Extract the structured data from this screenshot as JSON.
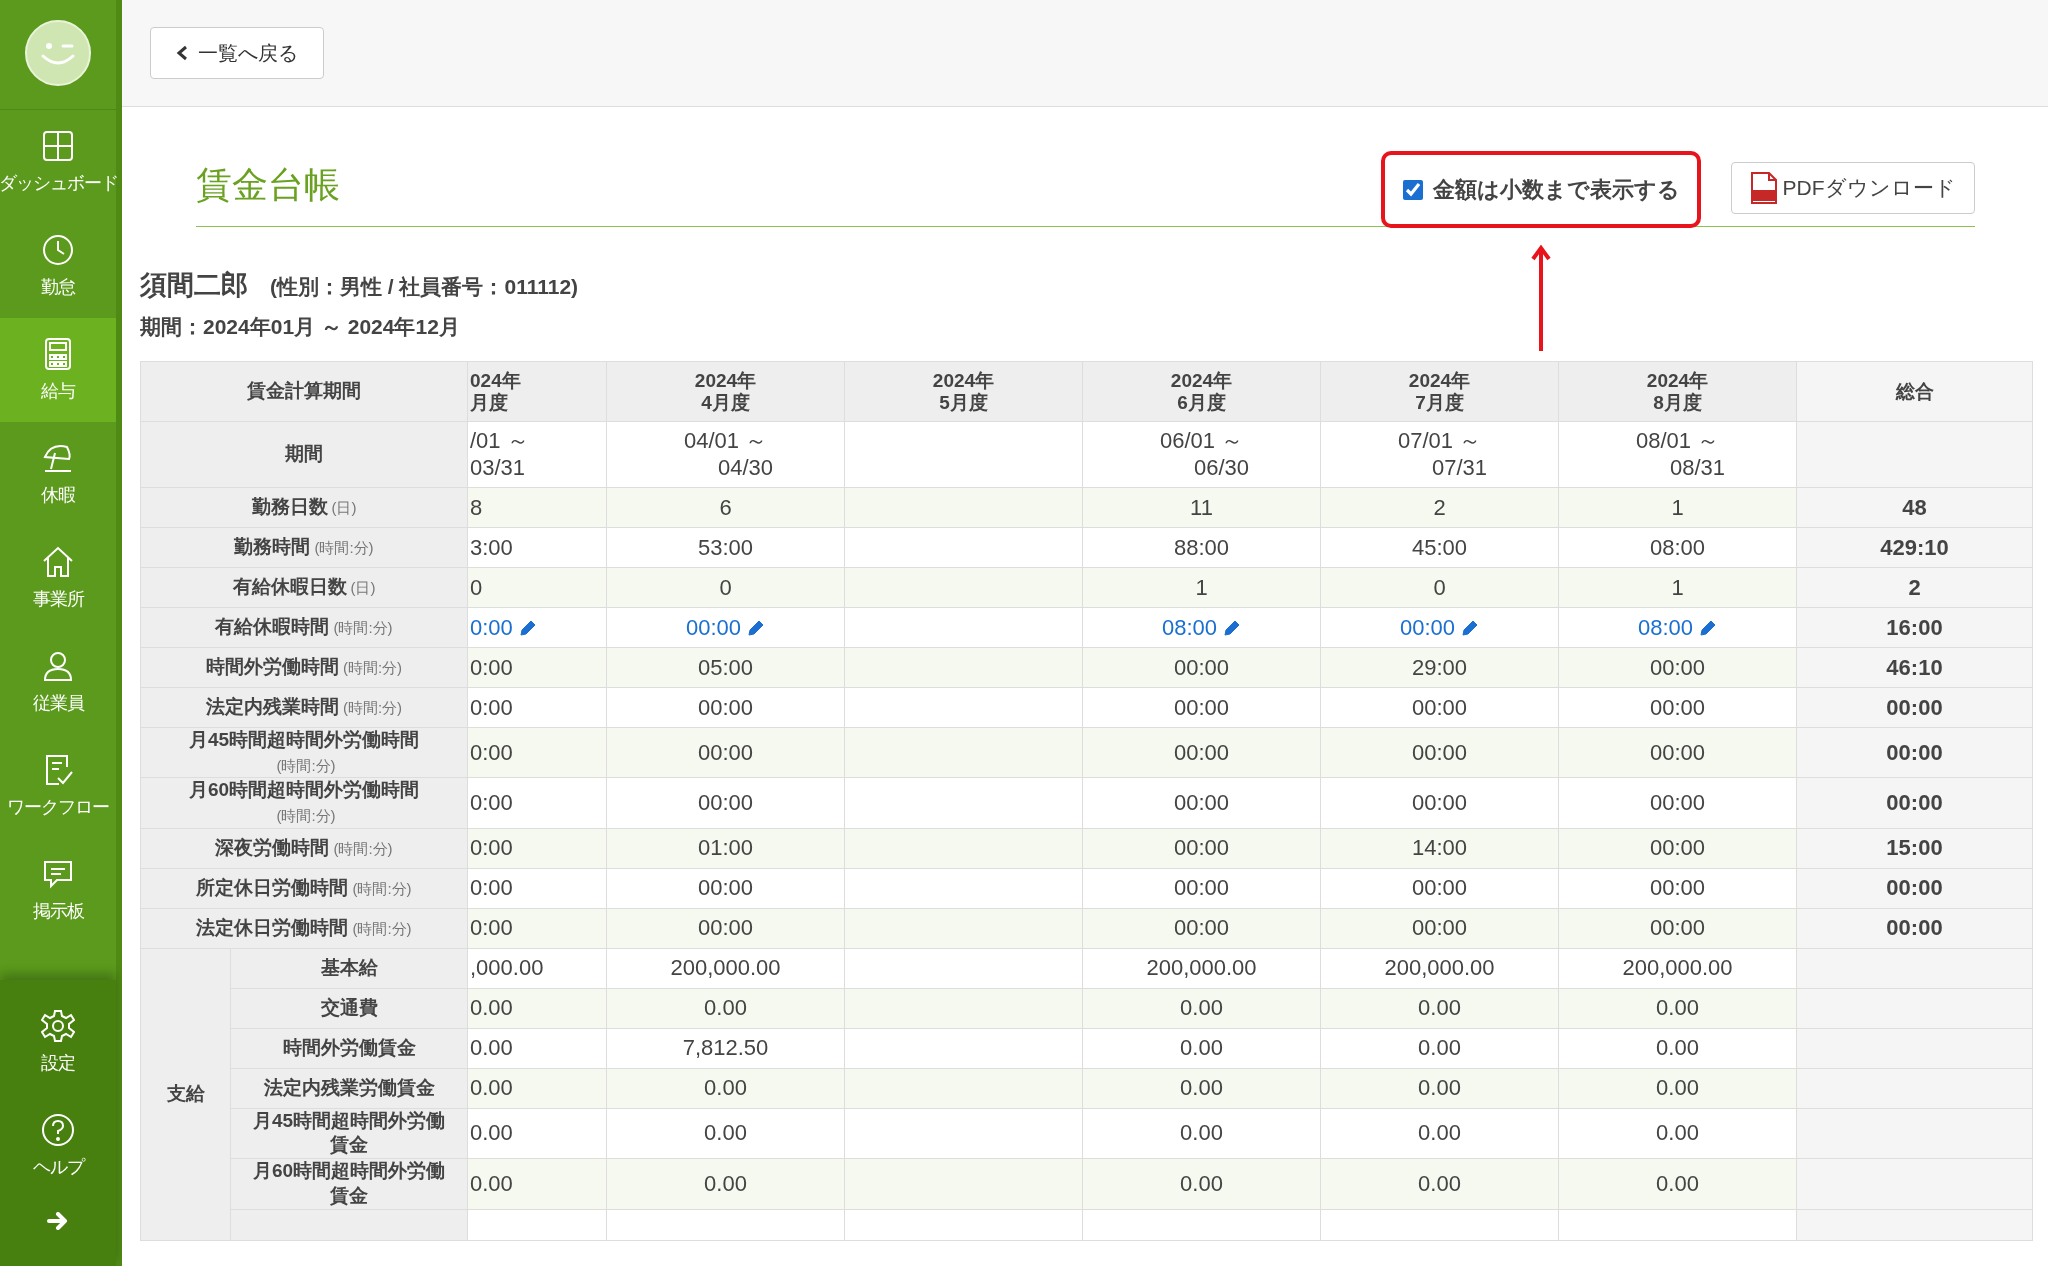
{
  "sidebar": {
    "items": [
      {
        "label": "ダッシュボード",
        "selected": false
      },
      {
        "label": "勤怠",
        "selected": false
      },
      {
        "label": "給与",
        "selected": true
      },
      {
        "label": "休暇",
        "selected": false
      },
      {
        "label": "事業所",
        "selected": false
      },
      {
        "label": "従業員",
        "selected": false
      },
      {
        "label": "ワークフロー",
        "selected": false
      },
      {
        "label": "掲示板",
        "selected": false
      }
    ],
    "bottom_items": [
      {
        "label": "設定"
      },
      {
        "label": "ヘルプ"
      }
    ]
  },
  "toolbar": {
    "back_button": "一覧へ戻る"
  },
  "page": {
    "title": "賃金台帳",
    "decimal_checkbox": {
      "label": "金額は小数まで表示する",
      "checked": true
    },
    "pdf_button": "PDFダウンロード"
  },
  "employee": {
    "name": "須間二郎",
    "details": "(性別：男性 / 社員番号：011112)",
    "period": "期間：2024年01月 ～ 2024年12月"
  },
  "ledger": {
    "corner": "賃金計算期間",
    "total_heading": "総合",
    "period_label": "期間",
    "payment_group": "支給",
    "rows": [
      {
        "label": "勤務日数",
        "unit": "(日)",
        "kind": "plain",
        "total": "48"
      },
      {
        "label": "勤務時間",
        "unit": "(時間:分)",
        "kind": "plain",
        "total": "429:10"
      },
      {
        "label": "有給休暇日数",
        "unit": "(日)",
        "kind": "plain",
        "total": "2"
      },
      {
        "label": "有給休暇時間",
        "unit": "(時間:分)",
        "kind": "editable",
        "total": "16:00"
      },
      {
        "label": "時間外労働時間",
        "unit": "(時間:分)",
        "kind": "plain",
        "total": "46:10"
      },
      {
        "label": "法定内残業時間",
        "unit": "(時間:分)",
        "kind": "plain",
        "total": "00:00"
      },
      {
        "label": "月45時間超時間外労働時間",
        "unit": "(時間:分)",
        "kind": "plain",
        "total": "00:00"
      },
      {
        "label": "月60時間超時間外労働時間",
        "unit": "(時間:分)",
        "kind": "plain",
        "total": "00:00"
      },
      {
        "label": "深夜労働時間",
        "unit": "(時間:分)",
        "kind": "plain",
        "total": "15:00"
      },
      {
        "label": "所定休日労働時間",
        "unit": "(時間:分)",
        "kind": "plain",
        "total": "00:00"
      },
      {
        "label": "法定休日労働時間",
        "unit": "(時間:分)",
        "kind": "plain",
        "total": "00:00"
      }
    ],
    "payment_rows": [
      {
        "label": "基本給"
      },
      {
        "label": "交通費"
      },
      {
        "label": "時間外労働賃金"
      },
      {
        "label": "法定内残業労働賃金"
      },
      {
        "label": "月45時間超時間外労働賃金"
      },
      {
        "label": "月60時間超時間外労働賃金"
      }
    ],
    "columns": [
      {
        "year": "024年",
        "month": "月度",
        "period_start": "/01 ～",
        "period_end": "03/31",
        "values": [
          "8",
          "3:00",
          "0",
          "0:00",
          "0:00",
          "0:00",
          "0:00",
          "0:00",
          "0:00",
          "0:00",
          "0:00"
        ],
        "payments": [
          ",000.00",
          "0.00",
          "0.00",
          "0.00",
          "0.00",
          "0.00"
        ]
      },
      {
        "year": "2024年",
        "month": "4月度",
        "period_start": "04/01 ～",
        "period_end": "04/30",
        "values": [
          "6",
          "53:00",
          "0",
          "00:00",
          "05:00",
          "00:00",
          "00:00",
          "00:00",
          "01:00",
          "00:00",
          "00:00"
        ],
        "payments": [
          "200,000.00",
          "0.00",
          "7,812.50",
          "0.00",
          "0.00",
          "0.00"
        ]
      },
      {
        "year": "2024年",
        "month": "5月度"
      },
      {
        "year": "2024年",
        "month": "6月度",
        "period_start": "06/01 ～",
        "period_end": "06/30",
        "values": [
          "11",
          "88:00",
          "1",
          "08:00",
          "00:00",
          "00:00",
          "00:00",
          "00:00",
          "00:00",
          "00:00",
          "00:00"
        ],
        "payments": [
          "200,000.00",
          "0.00",
          "0.00",
          "0.00",
          "0.00",
          "0.00"
        ]
      },
      {
        "year": "2024年",
        "month": "7月度",
        "period_start": "07/01 ～",
        "period_end": "07/31",
        "values": [
          "2",
          "45:00",
          "0",
          "00:00",
          "29:00",
          "00:00",
          "00:00",
          "00:00",
          "14:00",
          "00:00",
          "00:00"
        ],
        "payments": [
          "200,000.00",
          "0.00",
          "0.00",
          "0.00",
          "0.00",
          "0.00"
        ]
      },
      {
        "year": "2024年",
        "month": "8月度",
        "period_start": "08/01 ～",
        "period_end": "08/31",
        "values": [
          "1",
          "08:00",
          "1",
          "08:00",
          "00:00",
          "00:00",
          "00:00",
          "00:00",
          "00:00",
          "00:00",
          "00:00"
        ],
        "payments": [
          "200,000.00",
          "0.00",
          "0.00",
          "0.00",
          "0.00",
          "0.00"
        ]
      }
    ]
  }
}
